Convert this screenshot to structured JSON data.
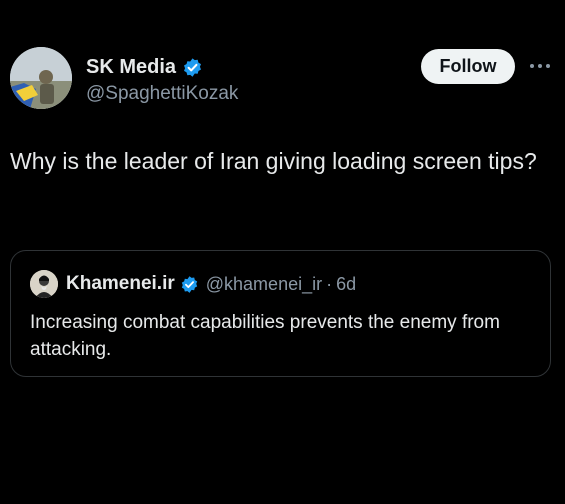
{
  "tweet": {
    "author": {
      "display_name": "SK Media",
      "handle": "@SpaghettiKozak",
      "verified_icon": "verified-badge-icon"
    },
    "follow_label": "Follow",
    "more_icon": "more-options-icon",
    "text": "Why is the leader of Iran giving loading screen tips?"
  },
  "quote": {
    "author": {
      "display_name": "Khamenei.ir",
      "handle": "@khamenei_ir",
      "verified_icon": "verified-badge-icon"
    },
    "separator": "·",
    "time": "6d",
    "text": "Increasing combat capabilities prevents the enemy from attacking."
  },
  "colors": {
    "background": "#000000",
    "text_primary": "#e7e9ea",
    "text_secondary": "#8b98a5",
    "verified_blue": "#1d9bf0",
    "border": "#2f3336",
    "follow_bg": "#eff3f4"
  }
}
